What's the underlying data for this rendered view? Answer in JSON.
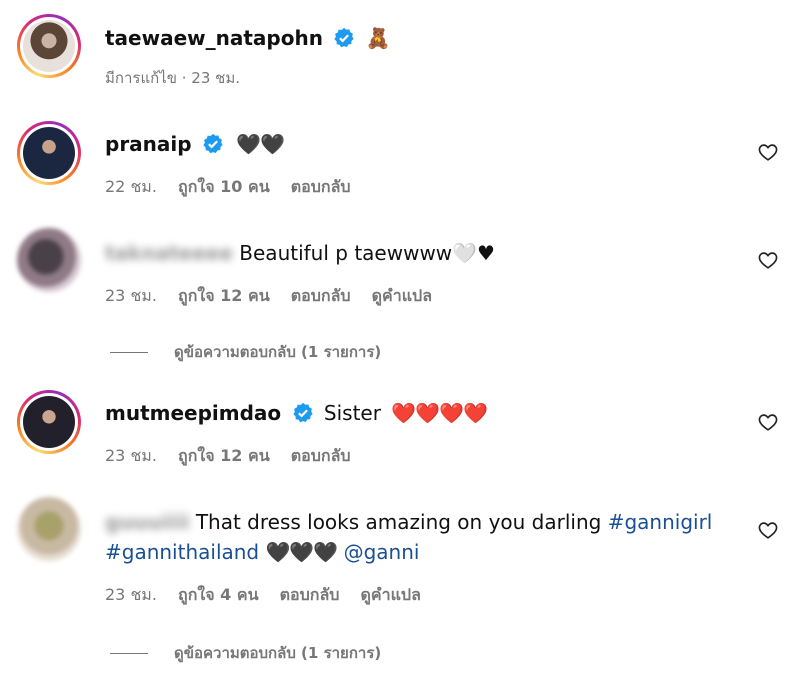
{
  "post": {
    "username": "taewaew_natapohn",
    "emoji": "🧸",
    "meta_edited": "มีการแก้ไข · 23 ชม."
  },
  "comments": [
    {
      "username": "pranaip",
      "text": "🖤🖤",
      "time": "22 ชม.",
      "likes": "ถูกใจ 10 คน",
      "reply": "ตอบกลับ"
    },
    {
      "username": "taknateeee",
      "text": "Beautiful p taewwww🤍♥",
      "time": "23 ชม.",
      "likes": "ถูกใจ 12 คน",
      "reply": "ตอบกลับ",
      "translate": "ดูคำแปล",
      "view_replies": "ดูข้อความตอบกลับ (1 รายการ)"
    },
    {
      "username": "mutmeepimdao",
      "text": "Sister",
      "hearts": "❤️❤️❤️❤️",
      "time": "23 ชม.",
      "likes": "ถูกใจ 12 คน",
      "reply": "ตอบกลับ"
    },
    {
      "username": "guuuiiii",
      "text": "That dress looks amazing on you darling",
      "hashtag1": "#gannigirl",
      "hashtag2": "#gannithailand",
      "hearts": "🖤🖤🖤",
      "mention": "@ganni",
      "time": "23 ชม.",
      "likes": "ถูกใจ 4 คน",
      "reply": "ตอบกลับ",
      "translate": "ดูคำแปล",
      "view_replies": "ดูข้อความตอบกลับ (1 รายการ)"
    }
  ],
  "colors": {
    "verified_blue": "#1d9bf0",
    "link_blue": "#1a4f95",
    "meta_gray": "#777777"
  },
  "icons": {
    "verified": "verified-badge-icon",
    "like": "heart-outline-icon"
  }
}
